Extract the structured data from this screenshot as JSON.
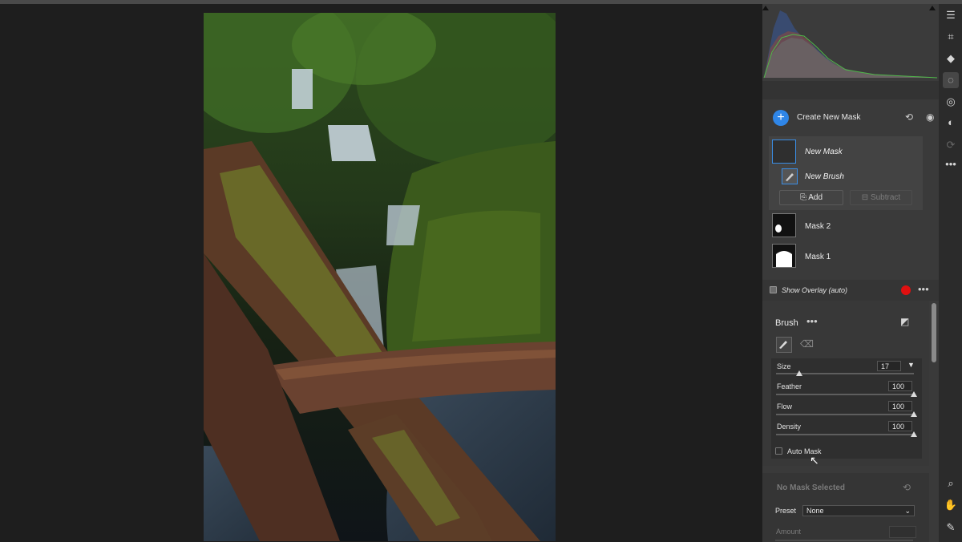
{
  "mask_panel": {
    "create_label": "Create New Mask",
    "items": {
      "new_mask_label": "New Mask",
      "new_brush_label": "New Brush",
      "add_label": "Add",
      "subtract_label": "Subtract"
    },
    "mask2_label": "Mask 2",
    "mask1_label": "Mask 1",
    "overlay_label": "Show Overlay (auto)",
    "overlay_color": "#e01010"
  },
  "brush": {
    "title": "Brush",
    "size_label": "Size",
    "size_value": "17",
    "size_fraction": 0.17,
    "feather_label": "Feather",
    "feather_value": "100",
    "flow_label": "Flow",
    "flow_value": "100",
    "density_label": "Density",
    "density_value": "100",
    "auto_mask_label": "Auto Mask"
  },
  "no_mask": {
    "title": "No Mask Selected",
    "preset_label": "Preset",
    "preset_value": "None",
    "amount_label": "Amount"
  },
  "colors": {
    "accent": "#2f86e8",
    "panel_bg": "#3a3a3a",
    "canvas_bg": "#1e1e1e"
  },
  "toolbar_icons": [
    "sliders-icon",
    "crop-icon",
    "eraser-icon",
    "mask-icon",
    "redeye-icon",
    "preset-icon",
    "sync-icon",
    "more-icon",
    "zoom-icon",
    "hand-icon",
    "eyedropper-icon"
  ]
}
